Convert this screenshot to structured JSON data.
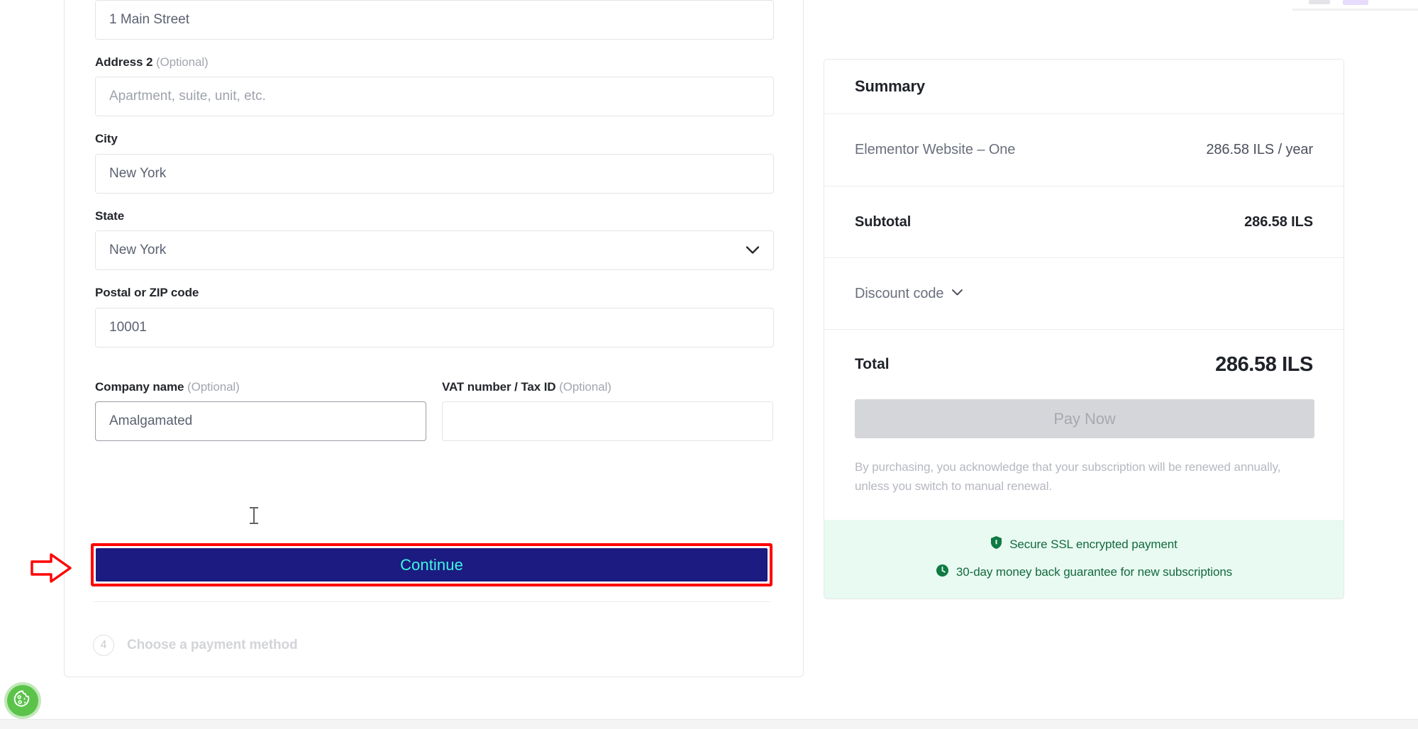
{
  "form": {
    "address1": {
      "value": "1 Main Street"
    },
    "address2": {
      "label": "Address 2",
      "optional": "(Optional)",
      "placeholder": "Apartment, suite, unit, etc."
    },
    "city": {
      "label": "City",
      "value": "New York"
    },
    "state": {
      "label": "State",
      "value": "New York",
      "chevron_icon": "chevron-down-icon"
    },
    "postal": {
      "label": "Postal or ZIP code",
      "value": "10001"
    },
    "company": {
      "label": "Company name",
      "optional": "(Optional)",
      "value": "Amalgamated"
    },
    "vat": {
      "label": "VAT number / Tax ID",
      "optional": "(Optional)",
      "value": ""
    },
    "continue_label": "Continue",
    "step4": {
      "number": "4",
      "label": "Choose a payment method"
    }
  },
  "summary": {
    "title": "Summary",
    "item": {
      "name": "Elementor Website – One",
      "price": "286.58 ILS / year"
    },
    "subtotal": {
      "label": "Subtotal",
      "value": "286.58 ILS"
    },
    "discount": {
      "label": "Discount code",
      "chevron_icon": "chevron-down-icon"
    },
    "total": {
      "label": "Total",
      "value": "286.58 ILS"
    },
    "pay_now_label": "Pay Now",
    "renewal_note": "By purchasing, you acknowledge that your subscription will be renewed annually, unless you switch to manual renewal.",
    "trust": [
      {
        "icon": "shield-icon",
        "text": "Secure SSL encrypted payment"
      },
      {
        "icon": "clock-icon",
        "text": "30-day money back guarantee for new subscriptions"
      }
    ]
  },
  "annotations": {
    "highlight_color": "#ff0000",
    "arrow_icon": "right-arrow-annotation-icon"
  },
  "widgets": {
    "cookie": {
      "icon": "cookie-icon",
      "color": "#5bc34a"
    }
  },
  "colors": {
    "continue_bg": "#1b1b82",
    "continue_text": "#3ff7df",
    "trust_band_bg": "#e8faf1",
    "trust_text": "#14693f"
  }
}
